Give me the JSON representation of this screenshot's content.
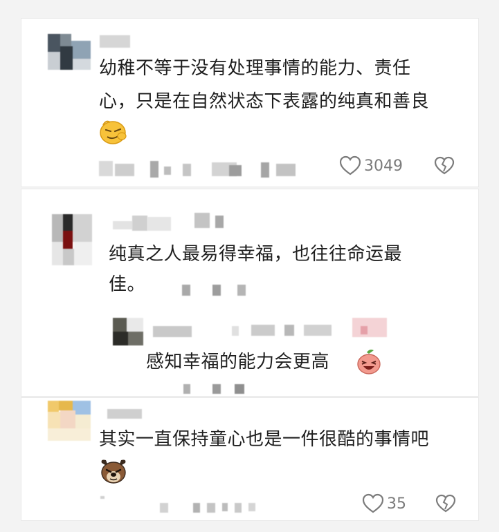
{
  "comments": [
    {
      "text_line1": "幼稚不等于没有处理事情的能力、责任",
      "text_line2": "心，只是在自然状态下表露的纯真和善良",
      "emoji_icon": "sly-smile-emoji",
      "like_count": "3049",
      "like_icon": "heart-outline-icon",
      "dislike_icon": "broken-heart-icon"
    },
    {
      "text_line1": "纯真之人最易得幸福，也往往命运最",
      "text_line2": "佳。",
      "reply": {
        "text": "感知幸福的能力会更高",
        "emoji_icon": "laughing-peach-emoji"
      }
    },
    {
      "text_line1": "其实一直保持童心也是一件很酷的事情吧",
      "emoji_icon": "dog-face-emoji",
      "like_count": "35",
      "like_icon": "heart-outline-icon",
      "dislike_icon": "broken-heart-icon"
    }
  ],
  "colors": {
    "text": "#1f1f1f",
    "meta": "#7b7b7b",
    "card": "#ffffff",
    "background": "#f3f3f3"
  }
}
